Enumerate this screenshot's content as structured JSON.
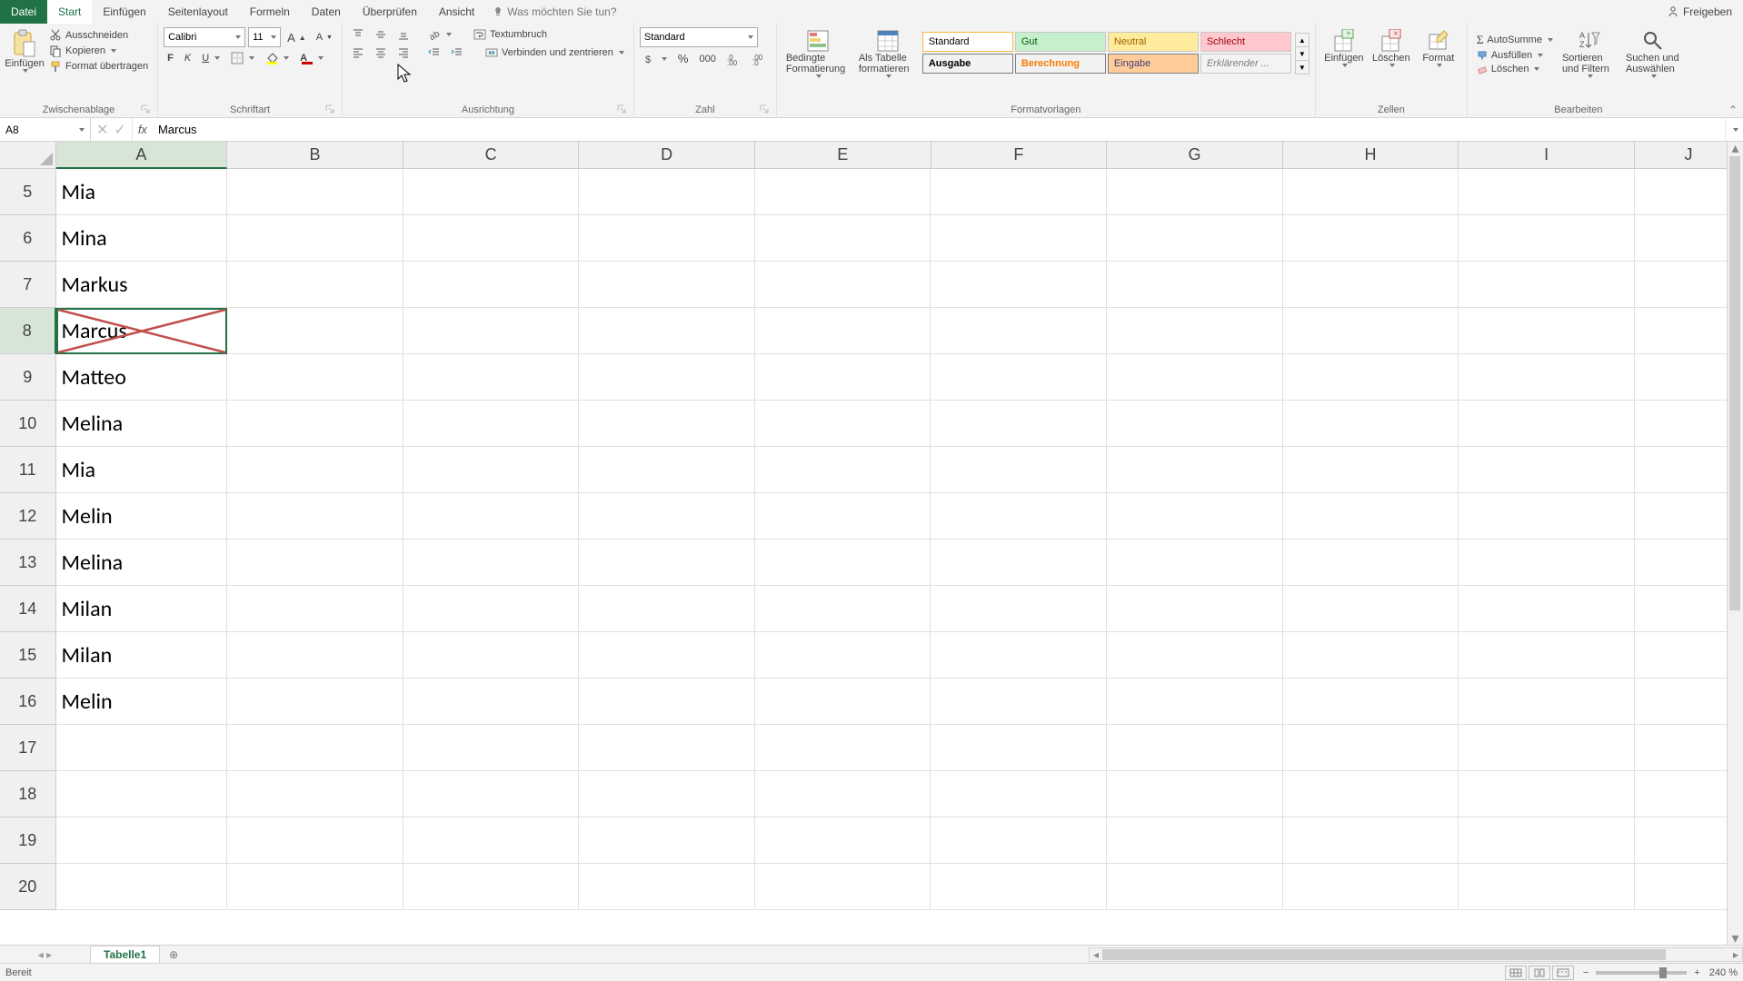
{
  "tabs": {
    "file": "Datei",
    "home": "Start",
    "insert": "Einfügen",
    "pagelayout": "Seitenlayout",
    "formulas": "Formeln",
    "data": "Daten",
    "review": "Überprüfen",
    "view": "Ansicht"
  },
  "search_placeholder": "Was möchten Sie tun?",
  "share": "Freigeben",
  "ribbon": {
    "clipboard": {
      "paste": "Einfügen",
      "cut": "Ausschneiden",
      "copy": "Kopieren",
      "format_painter": "Format übertragen",
      "label": "Zwischenablage"
    },
    "font": {
      "name": "Calibri",
      "size": "11",
      "label": "Schriftart"
    },
    "alignment": {
      "wrap": "Textumbruch",
      "merge": "Verbinden und zentrieren",
      "label": "Ausrichtung"
    },
    "number": {
      "format": "Standard",
      "label": "Zahl"
    },
    "styles": {
      "conditional": "Bedingte Formatierung",
      "as_table": "Als Tabelle formatieren",
      "s_standard": "Standard",
      "s_good": "Gut",
      "s_neutral": "Neutral",
      "s_bad": "Schlecht",
      "s_output": "Ausgabe",
      "s_calc": "Berechnung",
      "s_input": "Eingabe",
      "s_explain": "Erklärender ...",
      "label": "Formatvorlagen"
    },
    "cells": {
      "insert": "Einfügen",
      "delete": "Löschen",
      "format": "Format",
      "label": "Zellen"
    },
    "editing": {
      "autosum": "AutoSumme",
      "fill": "Ausfüllen",
      "clear": "Löschen",
      "sort": "Sortieren und Filtern",
      "find": "Suchen und Auswählen",
      "label": "Bearbeiten"
    }
  },
  "name_box": "A8",
  "formula_value": "Marcus",
  "columns": [
    "A",
    "B",
    "C",
    "D",
    "E",
    "F",
    "G",
    "H",
    "I",
    "J"
  ],
  "rows": [
    {
      "num": "5",
      "val": "Mia"
    },
    {
      "num": "6",
      "val": "Mina"
    },
    {
      "num": "7",
      "val": "Markus"
    },
    {
      "num": "8",
      "val": "Marcus"
    },
    {
      "num": "9",
      "val": "Matteo"
    },
    {
      "num": "10",
      "val": "Melina"
    },
    {
      "num": "11",
      "val": "Mia"
    },
    {
      "num": "12",
      "val": "Melin"
    },
    {
      "num": "13",
      "val": "Melina"
    },
    {
      "num": "14",
      "val": "Milan"
    },
    {
      "num": "15",
      "val": "Milan"
    },
    {
      "num": "16",
      "val": "Melin"
    },
    {
      "num": "17",
      "val": ""
    },
    {
      "num": "18",
      "val": ""
    },
    {
      "num": "19",
      "val": ""
    },
    {
      "num": "20",
      "val": ""
    }
  ],
  "active_row_index": 3,
  "sheet_tab": "Tabelle1",
  "status": "Bereit",
  "zoom": "240 %"
}
